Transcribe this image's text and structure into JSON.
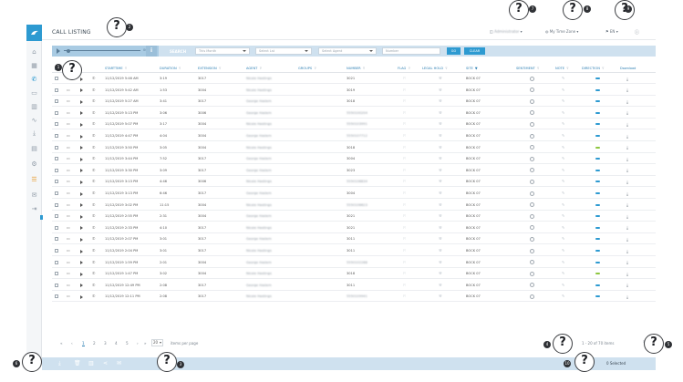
{
  "app": {
    "title": "CALL LISTING"
  },
  "header": {
    "user_label": "Administrator",
    "timezone_label": "My Time Zone",
    "language_label": "EN"
  },
  "toolbar": {
    "player_time": "00:00",
    "search_label": "SEARCH",
    "filters": [
      {
        "placeholder": "This Month"
      },
      {
        "placeholder": "Select Lst"
      },
      {
        "placeholder": "Select Agent"
      }
    ],
    "number_placeholder": "Number",
    "go_label": "GO",
    "clear_label": "CLEAR"
  },
  "table": {
    "columns": [
      "STARTTIME",
      "DURATION",
      "EXTENSION",
      "AGENT",
      "GROUPS",
      "NUMBER",
      "FLAG",
      "LEGAL HOLD",
      "SITE",
      "SENTIMENT",
      "NOTE",
      "DIRECTION"
    ],
    "download_header": "Download",
    "rows": [
      {
        "start": "11/12/2019 5:46 AM",
        "dur": "3:19",
        "ext": "3017",
        "agent": "Nicole Hastings",
        "group": "",
        "num": "3021",
        "site": "BOCK 07",
        "dir": "in"
      },
      {
        "start": "11/12/2019 5:42 AM",
        "dur": "1:53",
        "ext": "3004",
        "agent": "Nicole Hastings",
        "group": "",
        "num": "3019",
        "site": "BOCK 07",
        "dir": "in"
      },
      {
        "start": "11/12/2019 5:27 AM",
        "dur": "3:41",
        "ext": "3017",
        "agent": "George Haslem",
        "group": "",
        "num": "3018",
        "site": "BOCK 07",
        "dir": "in"
      },
      {
        "start": "11/12/2019 5:13 PM",
        "dur": "3:06",
        "ext": "3006",
        "agent": "George Haslem",
        "group": "",
        "num": "5550100204",
        "site": "BOCK 07",
        "dir": "in"
      },
      {
        "start": "11/12/2019 5:07 PM",
        "dur": "3:17",
        "ext": "3004",
        "agent": "Nicole Hastings",
        "group": "",
        "num": "5550103991",
        "site": "BOCK 07",
        "dir": "in"
      },
      {
        "start": "11/12/2019 4:47 PM",
        "dur": "4:04",
        "ext": "3004",
        "agent": "George Haslem",
        "group": "",
        "num": "5550107712",
        "site": "BOCK 07",
        "dir": "in"
      },
      {
        "start": "11/12/2019 3:50 PM",
        "dur": "3:05",
        "ext": "3004",
        "agent": "Nicole Hastings",
        "group": "",
        "num": "3018",
        "site": "BOCK 07",
        "dir": "out"
      },
      {
        "start": "11/12/2019 3:44 PM",
        "dur": "7:52",
        "ext": "3017",
        "agent": "George Haslem",
        "group": "",
        "num": "3004",
        "site": "BOCK 07",
        "dir": "in"
      },
      {
        "start": "11/12/2019 3:30 PM",
        "dur": "3:09",
        "ext": "3017",
        "agent": "George Haslem",
        "group": "",
        "num": "3023",
        "site": "BOCK 07",
        "dir": "in"
      },
      {
        "start": "11/12/2019 3:13 PM",
        "dur": "4:46",
        "ext": "3006",
        "agent": "Nicole Hastings",
        "group": "",
        "num": "5550108834",
        "site": "BOCK 07",
        "dir": "in"
      },
      {
        "start": "11/12/2019 3:13 PM",
        "dur": "6:46",
        "ext": "3017",
        "agent": "George Haslem",
        "group": "",
        "num": "3004",
        "site": "BOCK 07",
        "dir": "in"
      },
      {
        "start": "11/12/2019 3:02 PM",
        "dur": "11:15",
        "ext": "3004",
        "agent": "Nicole Hastings",
        "group": "",
        "num": "5550106623",
        "site": "BOCK 07",
        "dir": "in"
      },
      {
        "start": "11/12/2019 2:55 PM",
        "dur": "2:31",
        "ext": "3004",
        "agent": "George Haslem",
        "group": "",
        "num": "3021",
        "site": "BOCK 07",
        "dir": "in"
      },
      {
        "start": "11/12/2019 2:33 PM",
        "dur": "4:10",
        "ext": "3017",
        "agent": "Nicole Hastings",
        "group": "",
        "num": "3021",
        "site": "BOCK 07",
        "dir": "in"
      },
      {
        "start": "11/12/2019 2:07 PM",
        "dur": "3:01",
        "ext": "3017",
        "agent": "George Haslem",
        "group": "",
        "num": "3011",
        "site": "BOCK 07",
        "dir": "in"
      },
      {
        "start": "11/12/2019 2:04 PM",
        "dur": "3:01",
        "ext": "3017",
        "agent": "Nicole Hastings",
        "group": "",
        "num": "3011",
        "site": "BOCK 07",
        "dir": "in"
      },
      {
        "start": "11/12/2019 1:59 PM",
        "dur": "2:01",
        "ext": "3004",
        "agent": "George Haslem",
        "group": "",
        "num": "5550102288",
        "site": "BOCK 07",
        "dir": "in"
      },
      {
        "start": "11/12/2019 1:47 PM",
        "dur": "3:02",
        "ext": "3004",
        "agent": "Nicole Hastings",
        "group": "",
        "num": "3018",
        "site": "BOCK 07",
        "dir": "out"
      },
      {
        "start": "11/12/2019 12:49 PM",
        "dur": "2:08",
        "ext": "3017",
        "agent": "George Haslem",
        "group": "",
        "num": "3011",
        "site": "BOCK 07",
        "dir": "in"
      },
      {
        "start": "11/12/2019 12:11 PM",
        "dur": "2:08",
        "ext": "3017",
        "agent": "Nicole Hastings",
        "group": "",
        "num": "5550109941",
        "site": "BOCK 07",
        "dir": "in"
      }
    ]
  },
  "pager": {
    "pages": [
      "1",
      "2",
      "3",
      "4",
      "5"
    ],
    "first": "«",
    "prev": "‹",
    "next": "›",
    "last": "»",
    "page_size": "20",
    "items_per_page": "items per page",
    "info": "1 - 20 of 70 items"
  },
  "footer": {
    "selected": "0 Selected"
  },
  "help": {
    "glyph": "?",
    "numbers": [
      "1",
      "2",
      "7",
      "8",
      "9",
      "4",
      "5",
      "10",
      "6",
      "3"
    ]
  },
  "colors": {
    "accent": "#2d9ad1",
    "toolbar_bg": "#cfe1ef",
    "dir_in": "#2d9ad1",
    "dir_out": "#8dc63f"
  },
  "icons": {
    "nav": [
      "home-icon",
      "calendar-icon",
      "phone-icon",
      "screen-icon",
      "chart-icon",
      "analytics-icon",
      "download-icon",
      "clipboard-icon",
      "gear-icon",
      "list-icon",
      "mail-icon",
      "logout-icon"
    ]
  }
}
